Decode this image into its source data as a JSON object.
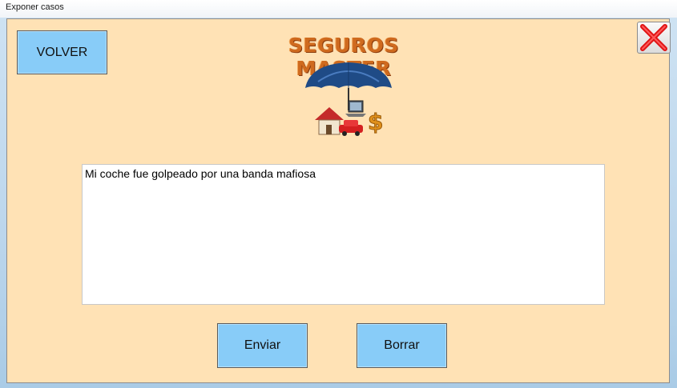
{
  "window": {
    "title": "Exponer casos"
  },
  "header": {
    "back_label": "VOLVER",
    "brand": "SEGUROS MASTER"
  },
  "case_form": {
    "text": "Mi coche fue golpeado por una banda mafiosa"
  },
  "actions": {
    "send_label": "Enviar",
    "clear_label": "Borrar"
  },
  "icons": {
    "close": "close-icon",
    "logo": "insurance-umbrella-logo"
  },
  "colors": {
    "client_bg": "#ffe2b5",
    "button_bg": "#88ccf8",
    "brand_orange": "#cf6a1e",
    "close_red": "#e01414"
  }
}
